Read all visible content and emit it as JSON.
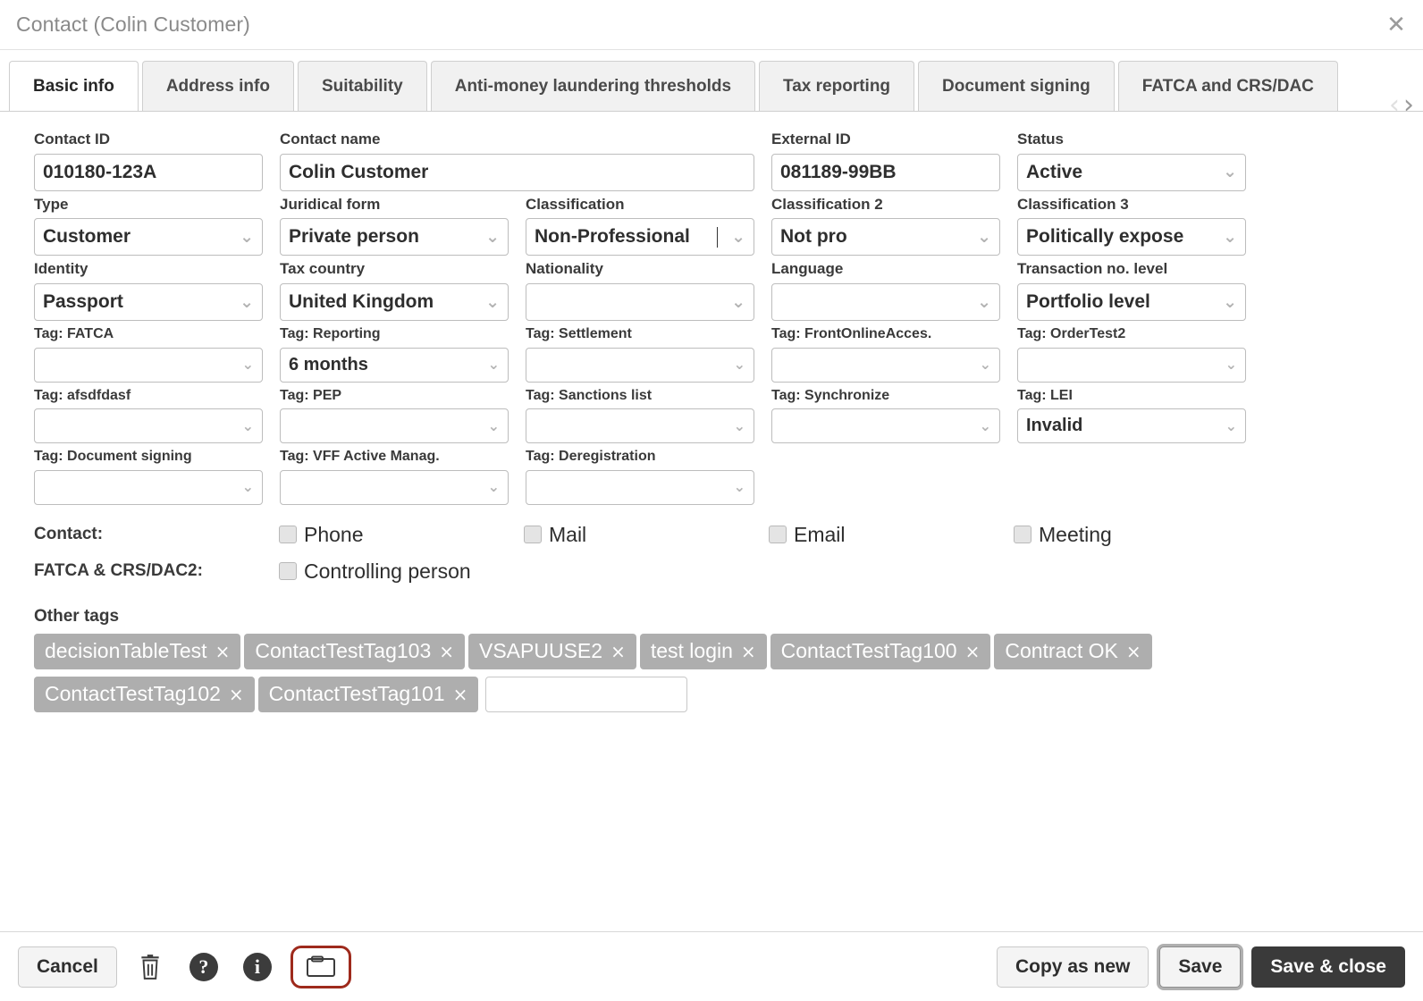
{
  "window": {
    "title": "Contact (Colin Customer)",
    "close_label": "✕"
  },
  "tabs": {
    "items": [
      {
        "label": "Basic info",
        "active": true
      },
      {
        "label": "Address info",
        "active": false
      },
      {
        "label": "Suitability",
        "active": false
      },
      {
        "label": "Anti-money laundering thresholds",
        "active": false
      },
      {
        "label": "Tax reporting",
        "active": false
      },
      {
        "label": "Document signing",
        "active": false
      },
      {
        "label": "FATCA and CRS/DAC",
        "active": false
      }
    ],
    "prev_label": "‹",
    "next_label": "›"
  },
  "fields": {
    "contact_id": {
      "label": "Contact ID",
      "value": "010180-123A",
      "type": "text"
    },
    "contact_name": {
      "label": "Contact name",
      "value": "Colin Customer",
      "type": "text"
    },
    "external_id": {
      "label": "External ID",
      "value": "081189-99BB",
      "type": "text"
    },
    "status": {
      "label": "Status",
      "value": "Active",
      "type": "select"
    },
    "type": {
      "label": "Type",
      "value": "Customer",
      "type": "select"
    },
    "juridical_form": {
      "label": "Juridical form",
      "value": "Private person",
      "type": "select"
    },
    "classification": {
      "label": "Classification",
      "value": "Non-Professional",
      "type": "select"
    },
    "classification2": {
      "label": "Classification 2",
      "value": "Not pro",
      "type": "select"
    },
    "classification3": {
      "label": "Classification 3",
      "value": "Politically expose",
      "type": "select"
    },
    "identity": {
      "label": "Identity",
      "value": "Passport",
      "type": "select"
    },
    "tax_country": {
      "label": "Tax country",
      "value": "United Kingdom",
      "type": "select"
    },
    "nationality": {
      "label": "Nationality",
      "value": "",
      "type": "select"
    },
    "language": {
      "label": "Language",
      "value": "",
      "type": "select"
    },
    "transaction_level": {
      "label": "Transaction no. level",
      "value": "Portfolio level",
      "type": "select"
    },
    "tag_fatca": {
      "label": "Tag: FATCA",
      "value": "",
      "type": "select"
    },
    "tag_reporting": {
      "label": "Tag: Reporting",
      "value": "6 months",
      "type": "select"
    },
    "tag_settlement": {
      "label": "Tag: Settlement",
      "value": "",
      "type": "select"
    },
    "tag_frontonline": {
      "label": "Tag: FrontOnlineAcces.",
      "value": "",
      "type": "select"
    },
    "tag_ordertest2": {
      "label": "Tag: OrderTest2",
      "value": "",
      "type": "select"
    },
    "tag_afsdfdasf": {
      "label": "Tag: afsdfdasf",
      "value": "",
      "type": "select"
    },
    "tag_pep": {
      "label": "Tag: PEP",
      "value": "",
      "type": "select"
    },
    "tag_sanctions": {
      "label": "Tag: Sanctions list",
      "value": "",
      "type": "select"
    },
    "tag_synchronize": {
      "label": "Tag: Synchronize",
      "value": "",
      "type": "select"
    },
    "tag_lei": {
      "label": "Tag: LEI",
      "value": "Invalid",
      "type": "select"
    },
    "tag_docsigning": {
      "label": "Tag: Document signing",
      "value": "",
      "type": "select"
    },
    "tag_vff": {
      "label": "Tag: VFF Active Manag.",
      "value": "",
      "type": "select"
    },
    "tag_dereg": {
      "label": "Tag: Deregistration",
      "value": "",
      "type": "select"
    }
  },
  "contact_methods": {
    "label": "Contact:",
    "options": [
      {
        "label": "Phone",
        "checked": false
      },
      {
        "label": "Mail",
        "checked": false
      },
      {
        "label": "Email",
        "checked": false
      },
      {
        "label": "Meeting",
        "checked": false
      }
    ]
  },
  "fatca_crs": {
    "label": "FATCA & CRS/DAC2:",
    "options": [
      {
        "label": "Controlling person",
        "checked": false
      }
    ]
  },
  "other_tags": {
    "label": "Other tags",
    "remove_label": "×",
    "chips": [
      "decisionTableTest",
      "ContactTestTag103",
      "VSAPUUSE2",
      "test login",
      "ContactTestTag100",
      "Contract OK",
      "ContactTestTag102",
      "ContactTestTag101"
    ],
    "input_value": "",
    "input_placeholder": ""
  },
  "footer": {
    "cancel_label": "Cancel",
    "copy_as_new_label": "Copy as new",
    "save_label": "Save",
    "save_close_label": "Save & close",
    "help_label": "?",
    "info_label": "i",
    "icons": [
      "trash-icon",
      "help-icon",
      "info-icon",
      "window-icon"
    ],
    "highlight_color": "#9e2a1c"
  },
  "colors": {
    "chip_bg": "#aeaeae",
    "dark_button": "#3a3a3a",
    "border": "#bdbdbd"
  },
  "caret_glyph": "⌄"
}
